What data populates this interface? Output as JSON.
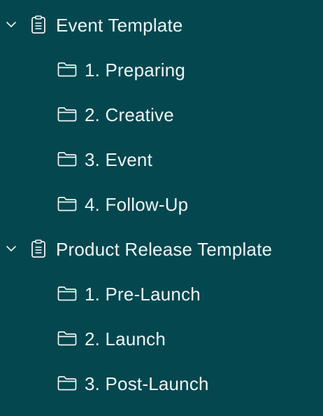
{
  "tree": {
    "groups": [
      {
        "title": "Event Template",
        "icon": "document-icon",
        "expanded": true,
        "children": [
          {
            "label": "1. Preparing",
            "icon": "folder-icon"
          },
          {
            "label": "2. Creative",
            "icon": "folder-icon"
          },
          {
            "label": "3. Event",
            "icon": "folder-icon"
          },
          {
            "label": "4. Follow-Up",
            "icon": "folder-icon"
          }
        ]
      },
      {
        "title": "Product Release Template",
        "icon": "document-icon",
        "expanded": true,
        "children": [
          {
            "label": "1. Pre-Launch",
            "icon": "folder-icon"
          },
          {
            "label": "2. Launch",
            "icon": "folder-icon"
          },
          {
            "label": "3. Post-Launch",
            "icon": "folder-icon"
          }
        ]
      }
    ]
  },
  "colors": {
    "background": "#04474f",
    "text": "#eef4f5"
  }
}
